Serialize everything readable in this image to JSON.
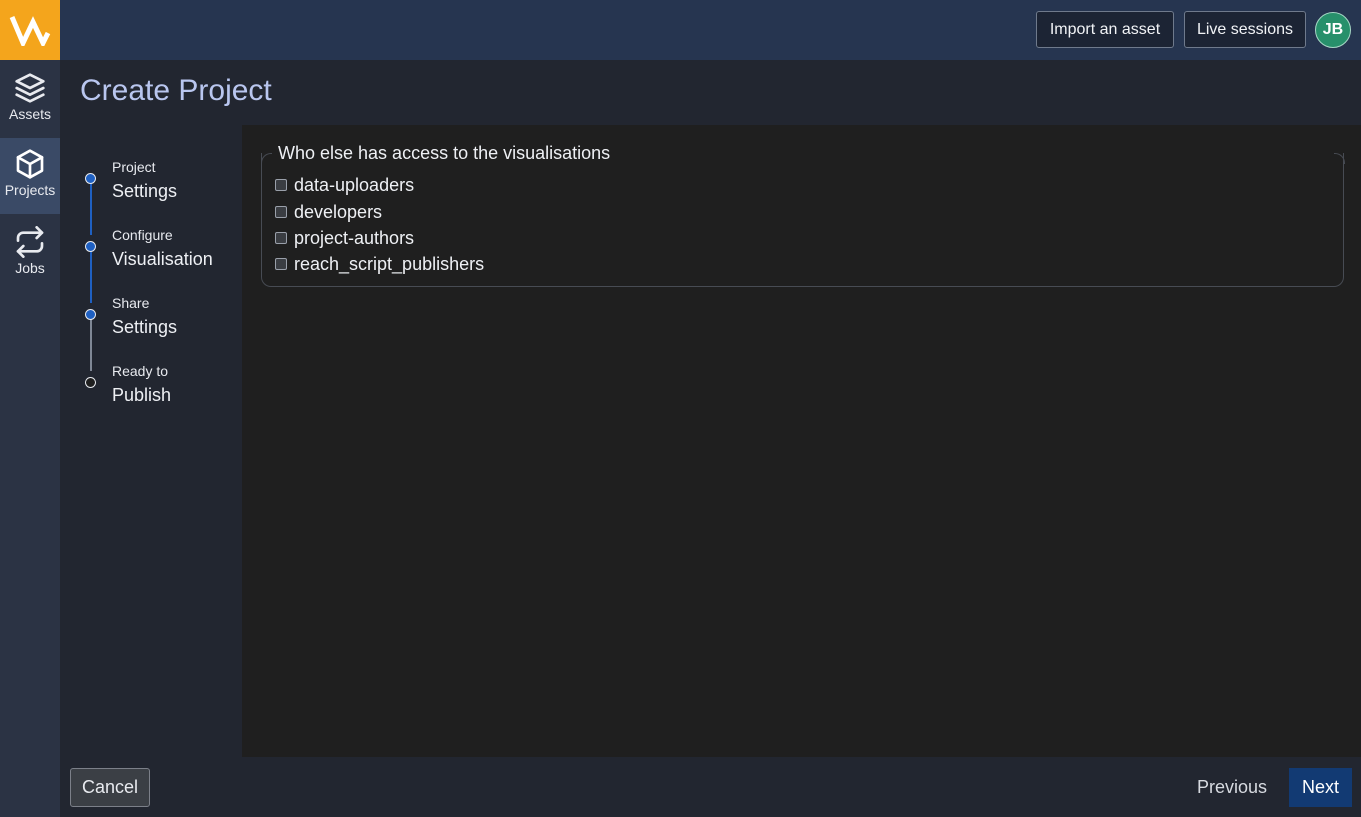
{
  "topbar": {
    "import_label": "Import an asset",
    "live_label": "Live sessions",
    "avatar_initials": "JB"
  },
  "nav": {
    "items": [
      {
        "label": "Assets",
        "icon": "layers-icon",
        "active": false
      },
      {
        "label": "Projects",
        "icon": "cube-icon",
        "active": true
      },
      {
        "label": "Jobs",
        "icon": "repeat-icon",
        "active": false
      }
    ]
  },
  "page": {
    "title": "Create Project"
  },
  "steps": [
    {
      "small": "Project",
      "large": "Settings",
      "state": "complete"
    },
    {
      "small": "Configure",
      "large": "Visualisation",
      "state": "complete"
    },
    {
      "small": "Share",
      "large": "Settings",
      "state": "current"
    },
    {
      "small": "Ready to",
      "large": "Publish",
      "state": "pending"
    }
  ],
  "access": {
    "legend": "Who else has access to the visualisations",
    "options": [
      {
        "label": "data-uploaders",
        "checked": false
      },
      {
        "label": "developers",
        "checked": false
      },
      {
        "label": "project-authors",
        "checked": false
      },
      {
        "label": "reach_script_publishers",
        "checked": false
      }
    ]
  },
  "footer": {
    "cancel_label": "Cancel",
    "previous_label": "Previous",
    "next_label": "Next"
  },
  "colors": {
    "brand_orange": "#f4a51c",
    "topbar": "#263550",
    "step_active": "#1f60c2",
    "next_button": "#123a73",
    "avatar": "#27906b"
  }
}
